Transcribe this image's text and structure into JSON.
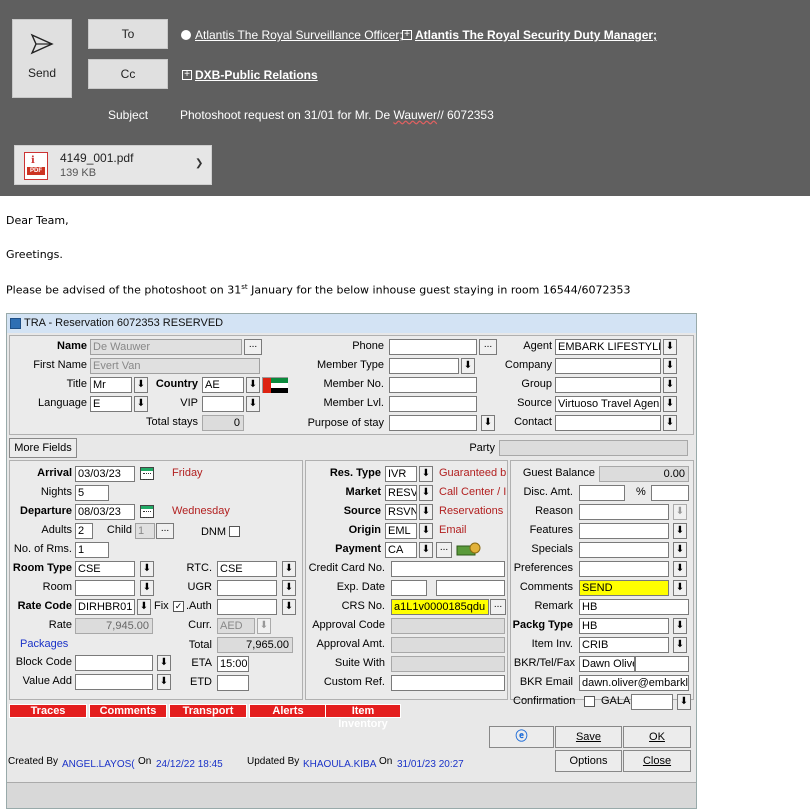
{
  "email": {
    "send_label": "Send",
    "to_label": "To",
    "cc_label": "Cc",
    "subject_label": "Subject",
    "to_recipients": [
      "Atlantis The Royal Surveillance Officer;",
      "Atlantis The Royal Security Duty Manager;"
    ],
    "cc_recipients": [
      "DXB-Public Relations"
    ],
    "subject_pre": "Photoshoot request on 31/01 for Mr. De ",
    "subject_u": "Wauwer",
    "subject_post": "// 6072353",
    "attachment": {
      "name": "4149_001.pdf",
      "size": "139 KB",
      "badge": "PDF"
    },
    "body": {
      "greeting": "Dear Team,",
      "line2": "Greetings.",
      "line3_pre": "Please be advised of the photoshoot on 31",
      "line3_sup": "st",
      "line3_post": " January for the below inhouse guest staying in room 16544/6072353"
    }
  },
  "app": {
    "title": "TRA - Reservation 6072353  RESERVED",
    "profile": {
      "name_label": "Name",
      "name": "De Wauwer",
      "first_label": "First Name",
      "first": "Evert Van",
      "title_label": "Title",
      "title": "Mr",
      "country_label": "Country",
      "country": "AE",
      "language_label": "Language",
      "language": "E",
      "vip_label": "VIP",
      "vip": "",
      "total_stays_label": "Total stays",
      "total_stays": "0",
      "phone_label": "Phone",
      "member_type_label": "Member Type",
      "member_no_label": "Member No.",
      "member_lvl_label": "Member Lvl.",
      "purpose_label": "Purpose of stay",
      "agent_label": "Agent",
      "agent": "EMBARK LIFESTYLE",
      "company_label": "Company",
      "group_label": "Group",
      "source_label": "Source",
      "source": "Virtuoso Travel Agen",
      "contact_label": "Contact"
    },
    "more_fields": "More Fields",
    "party_label": "Party",
    "stay": {
      "arrival_label": "Arrival",
      "arrival": "03/03/23",
      "arrival_day": "Friday",
      "nights_label": "Nights",
      "nights": "5",
      "departure_label": "Departure",
      "departure": "08/03/23",
      "departure_day": "Wednesday",
      "adults_label": "Adults",
      "adults": "2",
      "child_label": "Child",
      "child": "1",
      "dnm_label": "DNM",
      "rooms_label": "No. of Rms.",
      "rooms": "1",
      "room_type_label": "Room Type",
      "room_type": "CSE",
      "rtc_label": "RTC.",
      "rtc": "CSE",
      "room_label": "Room",
      "ugr_label": "UGR",
      "rate_code_label": "Rate Code",
      "rate_code": "DIRHBR01",
      "fix_label": "Fix",
      "auth_label": ".Auth",
      "rate_label": "Rate",
      "rate": "7,945.00",
      "curr_label": "Curr.",
      "curr": "AED",
      "packages_label": "Packages",
      "total_label": "Total",
      "total": "7,965.00",
      "block_label": "Block Code",
      "eta_label": "ETA",
      "eta": "15:00",
      "value_add_label": "Value Add",
      "etd_label": "ETD"
    },
    "res": {
      "res_type_label": "Res. Type",
      "res_type": "IVR",
      "res_type_desc": "Guaranteed b",
      "market_label": "Market",
      "market": "RESV",
      "market_desc": "Call Center / I",
      "source_label": "Source",
      "source": "RSVN",
      "source_desc": "Reservations",
      "origin_label": "Origin",
      "origin": "EML",
      "origin_desc": "Email",
      "payment_label": "Payment",
      "payment": "CA",
      "cc_label": "Credit Card No.",
      "exp_label": "Exp. Date",
      "crs_label": "CRS No.",
      "crs": "a1L1v0000185qdu",
      "approval_code_label": "Approval Code",
      "approval_amt_label": "Approval Amt.",
      "suite_label": "Suite With",
      "custom_label": "Custom Ref."
    },
    "guest": {
      "balance_label": "Guest Balance",
      "balance": "0.00",
      "disc_label": "Disc. Amt.",
      "pct": "%",
      "reason_label": "Reason",
      "features_label": "Features",
      "specials_label": "Specials",
      "preferences_label": "Preferences",
      "comments_label": "Comments",
      "comments": "SEND",
      "remark_label": "Remark",
      "remark": "HB",
      "packg_label": "Packg Type",
      "packg": "HB",
      "item_label": "Item Inv.",
      "item": "CRIB",
      "bkr_tel_label": "BKR/Tel/Fax",
      "bkr_tel": "Dawn Olive",
      "bkr_email_label": "BKR Email",
      "bkr_email": "dawn.oliver@embarkl",
      "confirmation_label": "Confirmation",
      "gala_label": "GALA"
    },
    "tabs": [
      "Traces",
      "Comments",
      "Transport",
      "Alerts",
      "Item Inventory"
    ],
    "buttons": {
      "save": "Save",
      "ok": "OK",
      "options": "Options",
      "close": "Close"
    },
    "footer": {
      "created_label": "Created By",
      "created_by": "ANGEL.LAYOS(",
      "on_label": "On",
      "created_on": "24/12/22 18:45",
      "updated_label": "Updated By",
      "updated_by": "KHAOULA.KIBA",
      "updated_on": "31/01/23 20:27"
    }
  }
}
